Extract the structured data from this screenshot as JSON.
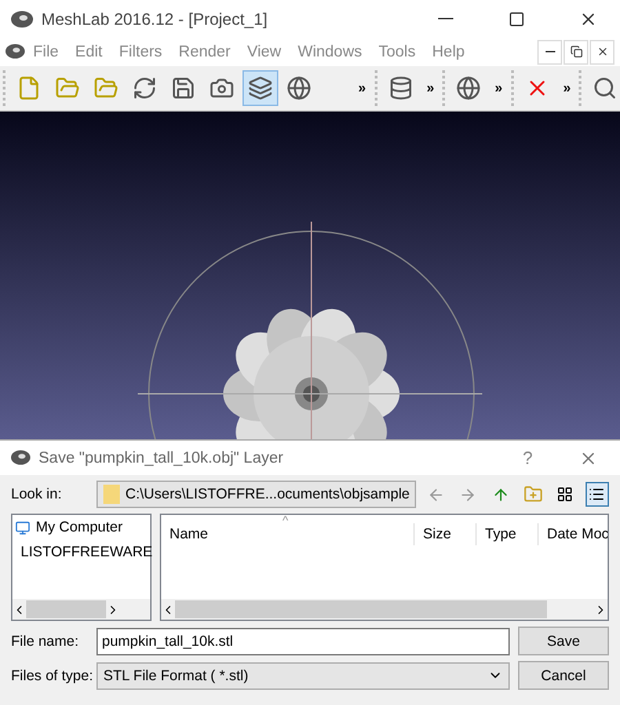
{
  "window": {
    "title": "MeshLab 2016.12 - [Project_1]"
  },
  "menu": [
    "File",
    "Edit",
    "Filters",
    "Render",
    "View",
    "Windows",
    "Tools",
    "Help"
  ],
  "toolbar": [
    {
      "buttons": [
        {
          "selected": false
        },
        {
          "selected": false
        },
        {
          "selected": false
        },
        {
          "selected": false
        },
        {
          "selected": false
        },
        {
          "selected": false
        },
        {
          "selected": true
        },
        {
          "selected": false
        }
      ],
      "overflow": "»"
    },
    {
      "buttons": [
        {
          "selected": false
        }
      ],
      "overflow": "»"
    },
    {
      "buttons": [
        {
          "selected": false
        }
      ],
      "overflow": "»"
    },
    {
      "buttons": [
        {
          "selected": false
        }
      ],
      "overflow": "»"
    },
    {
      "buttons": [
        {
          "selected": false
        }
      ]
    }
  ],
  "dialog": {
    "title": "Save \"pumpkin_tall_10k.obj\" Layer",
    "help": "?",
    "look_in_label": "Look in:",
    "path": "C:\\Users\\LISTOFFRE...ocuments\\objsample",
    "views": [
      {
        "selected": false
      },
      {
        "selected": true
      }
    ],
    "places": [
      "My Computer",
      "LISTOFFREEWARE"
    ],
    "columns": [
      "Name",
      "Size",
      "Type",
      "Date Moc"
    ],
    "sort_mark": "^",
    "file_name_label": "File name:",
    "file_name": "pumpkin_tall_10k.stl",
    "save": "Save",
    "type_label": "Files of type:",
    "file_type": "STL File Format ( *.stl)",
    "cancel": "Cancel"
  }
}
